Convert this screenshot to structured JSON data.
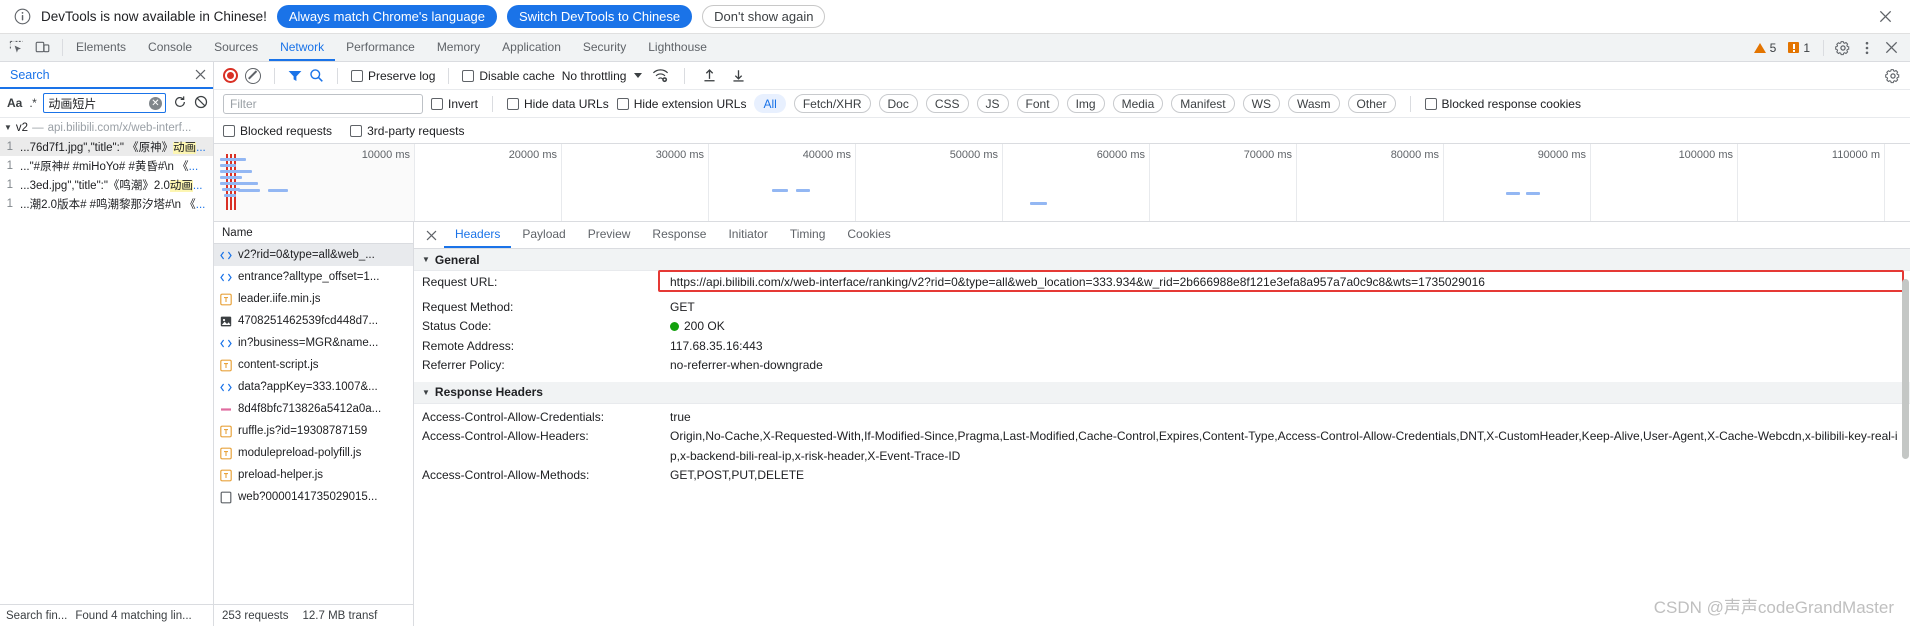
{
  "infobar": {
    "message": "DevTools is now available in Chinese!",
    "btn_always": "Always match Chrome's language",
    "btn_switch": "Switch DevTools to Chinese",
    "btn_dismiss": "Don't show again",
    "close_icon": "close-icon",
    "info_icon": "info-circle-icon"
  },
  "tabstrip": {
    "inspect_icon": "inspect-element-icon",
    "device_icon": "device-toolbar-icon",
    "tabs": [
      {
        "label": "Elements",
        "active": false
      },
      {
        "label": "Console",
        "active": false
      },
      {
        "label": "Sources",
        "active": false
      },
      {
        "label": "Network",
        "active": true
      },
      {
        "label": "Performance",
        "active": false
      },
      {
        "label": "Memory",
        "active": false
      },
      {
        "label": "Application",
        "active": false
      },
      {
        "label": "Security",
        "active": false
      },
      {
        "label": "Lighthouse",
        "active": false
      }
    ],
    "warning_count": "5",
    "error_count": "1",
    "settings_icon": "gear-icon",
    "more_icon": "more-vertical-icon",
    "close_icon": "close-icon"
  },
  "search_pane": {
    "title": "Search",
    "close_icon": "close-icon",
    "match_case_label": "Aa",
    "regex_label": ".*",
    "query": "动画短片",
    "placeholder": "",
    "clear_icon": "clear-icon",
    "refresh_icon": "refresh-icon",
    "clear_all_icon": "clear-all-icon",
    "group": {
      "name": "v2",
      "dash": "—",
      "url": "api.bilibili.com/x/web-interf..."
    },
    "results": [
      {
        "line": "1",
        "pre": "...76d7f1.jpg\",\"title\":\" 《原神》",
        "match": "动画",
        "post": "...",
        "selected": true
      },
      {
        "line": "1",
        "pre": "...\"#原神# #miHoYo# #黄昏#\\n 《",
        "match": "",
        "post": "...",
        "selected": false
      },
      {
        "line": "1",
        "pre": "...3ed.jpg\",\"title\":\"《鸣潮》2.0",
        "match": "动画",
        "post": "...",
        "selected": false
      },
      {
        "line": "1",
        "pre": "...潮2.0版本# #鸣潮黎那汐塔#\\n 《",
        "match": "",
        "post": "...",
        "selected": false
      }
    ],
    "status_left": "Search fin...",
    "status_right": "Found 4 matching lin..."
  },
  "network_toolbar": {
    "record_icon": "record-stop-icon",
    "clear_icon": "clear-network-icon",
    "filter_icon": "filter-funnel-icon",
    "search_icon": "search-icon",
    "preserve_log": "Preserve log",
    "disable_cache": "Disable cache",
    "throttling": "No throttling",
    "wifi_icon": "network-conditions-icon",
    "import_icon": "import-har-icon",
    "export_icon": "export-har-icon",
    "settings_icon": "gear-icon"
  },
  "filter_bar": {
    "filter_placeholder": "Filter",
    "filter_value": "",
    "invert": "Invert",
    "hide_data_urls": "Hide data URLs",
    "hide_extension_urls": "Hide extension URLs",
    "types": [
      {
        "label": "All",
        "active": true
      },
      {
        "label": "Fetch/XHR",
        "active": false
      },
      {
        "label": "Doc",
        "active": false
      },
      {
        "label": "CSS",
        "active": false
      },
      {
        "label": "JS",
        "active": false
      },
      {
        "label": "Font",
        "active": false
      },
      {
        "label": "Img",
        "active": false
      },
      {
        "label": "Media",
        "active": false
      },
      {
        "label": "Manifest",
        "active": false
      },
      {
        "label": "WS",
        "active": false
      },
      {
        "label": "Wasm",
        "active": false
      },
      {
        "label": "Other",
        "active": false
      }
    ],
    "blocked_response_cookies": "Blocked response cookies",
    "blocked_requests": "Blocked requests",
    "third_party_requests": "3rd-party requests"
  },
  "overview": {
    "ticks": [
      "10000 ms",
      "20000 ms",
      "30000 ms",
      "40000 ms",
      "50000 ms",
      "60000 ms",
      "70000 ms",
      "80000 ms",
      "90000 ms",
      "100000 ms",
      "110000 m"
    ]
  },
  "requests": {
    "header": "Name",
    "rows": [
      {
        "name": "v2?rid=0&type=all&web_...",
        "icon": "xhr-icon",
        "selected": true
      },
      {
        "name": "entrance?alltype_offset=1...",
        "icon": "xhr-icon",
        "selected": false
      },
      {
        "name": "leader.iife.min.js",
        "icon": "js-icon",
        "selected": false
      },
      {
        "name": "4708251462539fcd448d7...",
        "icon": "img-icon",
        "selected": false
      },
      {
        "name": "in?business=MGR&name...",
        "icon": "xhr-icon",
        "selected": false
      },
      {
        "name": "content-script.js",
        "icon": "js-icon",
        "selected": false
      },
      {
        "name": "data?appKey=333.1007&...",
        "icon": "xhr-icon",
        "selected": false
      },
      {
        "name": "8d4f8bfc713826a5412a0a...",
        "icon": "font-icon",
        "selected": false
      },
      {
        "name": "ruffle.js?id=19308787159",
        "icon": "js-icon",
        "selected": false
      },
      {
        "name": "modulepreload-polyfill.js",
        "icon": "js-icon",
        "selected": false
      },
      {
        "name": "preload-helper.js",
        "icon": "js-icon",
        "selected": false
      },
      {
        "name": "web?0000141735029015...",
        "icon": "doc-icon",
        "selected": false
      }
    ],
    "status_requests": "253 requests",
    "status_transferred": "12.7 MB transf"
  },
  "details": {
    "close_icon": "close-icon",
    "tabs": [
      {
        "label": "Headers",
        "active": true
      },
      {
        "label": "Payload",
        "active": false
      },
      {
        "label": "Preview",
        "active": false
      },
      {
        "label": "Response",
        "active": false
      },
      {
        "label": "Initiator",
        "active": false
      },
      {
        "label": "Timing",
        "active": false
      },
      {
        "label": "Cookies",
        "active": false
      }
    ],
    "general_header": "General",
    "general": [
      {
        "key": "Request URL:",
        "value": "https://api.bilibili.com/x/web-interface/ranking/v2?rid=0&type=all&web_location=333.934&w_rid=2b666988e8f121e3efa8a957a7a0c9c8&wts=1735029016",
        "highlighted": true
      },
      {
        "key": "Request Method:",
        "value": "GET",
        "highlighted": false
      },
      {
        "key": "Status Code:",
        "value": "200 OK",
        "status_dot": true,
        "highlighted": false
      },
      {
        "key": "Remote Address:",
        "value": "117.68.35.16:443",
        "highlighted": false
      },
      {
        "key": "Referrer Policy:",
        "value": "no-referrer-when-downgrade",
        "highlighted": false
      }
    ],
    "response_header": "Response Headers",
    "response": [
      {
        "key": "Access-Control-Allow-Credentials:",
        "value": "true"
      },
      {
        "key": "Access-Control-Allow-Headers:",
        "value": "Origin,No-Cache,X-Requested-With,If-Modified-Since,Pragma,Last-Modified,Cache-Control,Expires,Content-Type,Access-Control-Allow-Credentials,DNT,X-CustomHeader,Keep-Alive,User-Agent,X-Cache-Webcdn,x-bilibili-key-real-ip,x-backend-bili-real-ip,x-risk-header,X-Event-Trace-ID"
      },
      {
        "key": "Access-Control-Allow-Methods:",
        "value": "GET,POST,PUT,DELETE"
      }
    ]
  },
  "watermark": "CSDN @声声codeGrandMaster",
  "colors": {
    "accent": "#1a73e8",
    "warning": "#e37400",
    "error": "#d93025",
    "success": "#13a10e",
    "highlight_box": "#e53935"
  }
}
